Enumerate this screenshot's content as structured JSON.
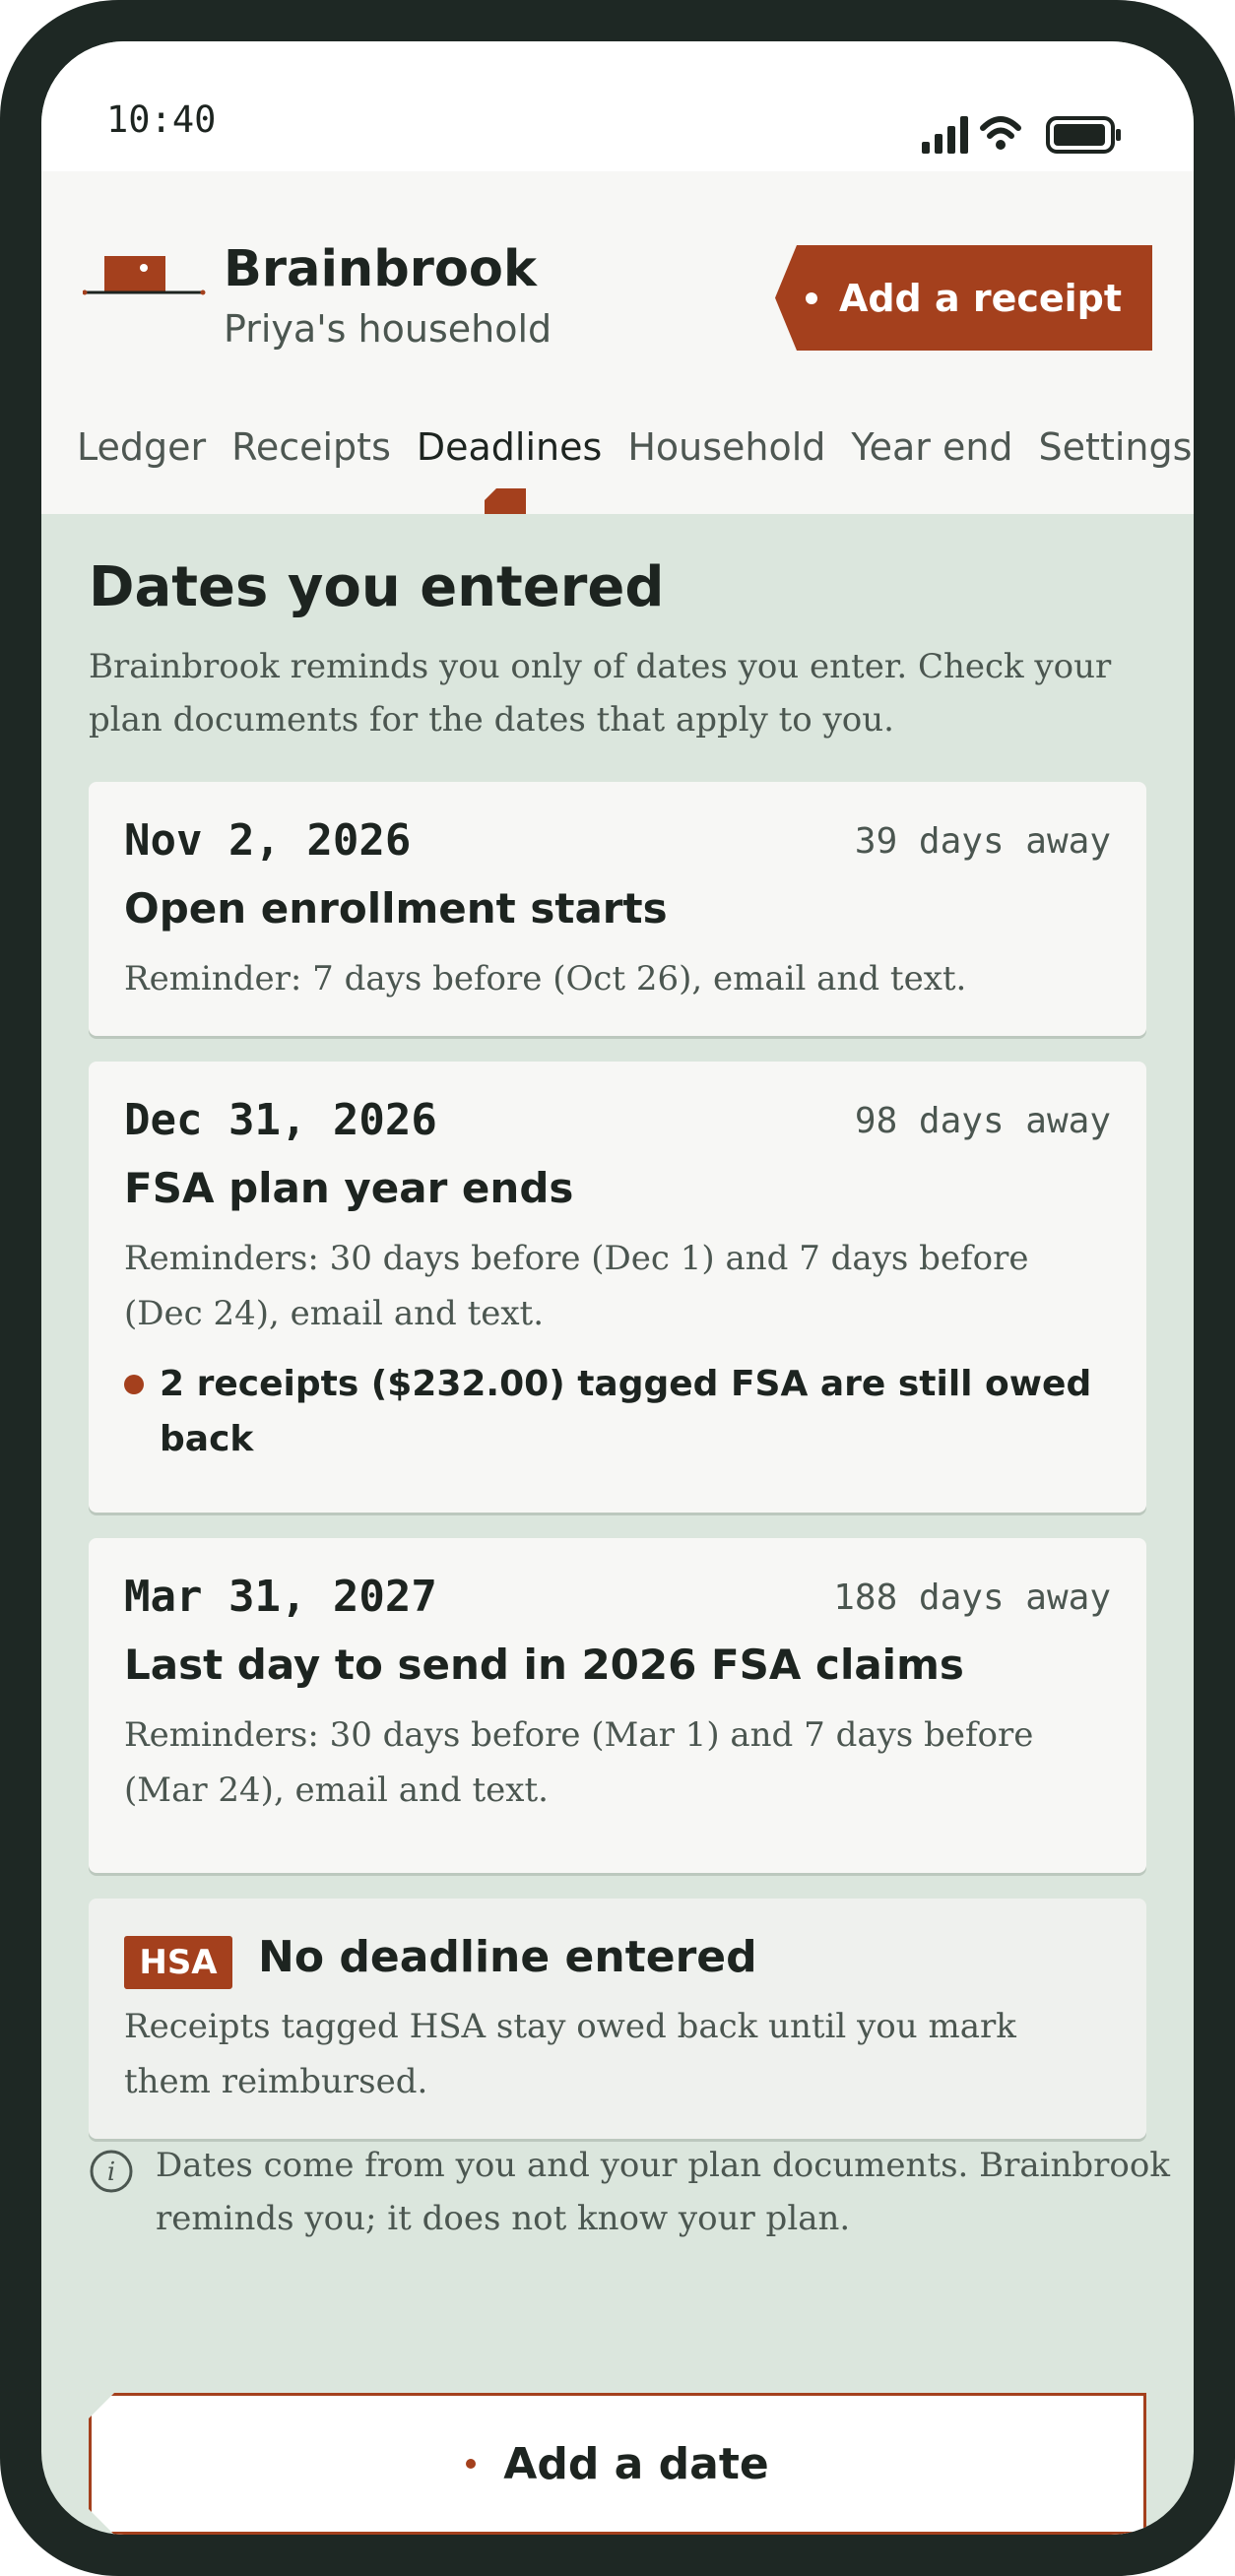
{
  "status_bar": {
    "time": "10:40"
  },
  "header": {
    "brand": "Brainbrook",
    "household": "Priya's household",
    "add_receipt_label": "Add a receipt"
  },
  "tabs": [
    {
      "label": "Ledger",
      "active": false
    },
    {
      "label": "Receipts",
      "active": false
    },
    {
      "label": "Deadlines",
      "active": true
    },
    {
      "label": "Household",
      "active": false
    },
    {
      "label": "Year end",
      "active": false
    },
    {
      "label": "Settings",
      "active": false
    }
  ],
  "main": {
    "heading": "Dates you entered",
    "intro": "Brainbrook reminds you only of dates you enter. Check your plan documents for the dates that apply to you.",
    "deadlines": [
      {
        "date": "Nov 2, 2026",
        "away": "39 days away",
        "title": "Open enrollment starts",
        "reminder": "Reminder: 7 days before (Oct 26), email and text."
      },
      {
        "date": "Dec 31, 2026",
        "away": "98 days away",
        "title": "FSA plan year ends",
        "reminder": "Reminders: 30 days before (Dec 1) and 7 days before (Dec 24), email and text.",
        "flag": "2 receipts ($232.00) tagged FSA are still owed back"
      },
      {
        "date": "Mar 31, 2027",
        "away": "188 days away",
        "title": "Last day to send in 2026 FSA claims",
        "reminder": "Reminders: 30 days before (Mar 1) and 7 days before (Mar 24), email and text."
      }
    ],
    "hsa": {
      "badge": "HSA",
      "title": "No deadline entered",
      "description": "Receipts tagged HSA stay owed back until you mark them reimbursed."
    },
    "note": "Dates come from you and your plan documents. Brainbrook reminds you; it does not know your plan.",
    "add_date_label": "Add a date"
  },
  "colors": {
    "accent": "#a4401d",
    "background": "#dbe6dd",
    "card": "#f7f7f5",
    "text": "#1d2420",
    "frame": "#1e2824"
  }
}
